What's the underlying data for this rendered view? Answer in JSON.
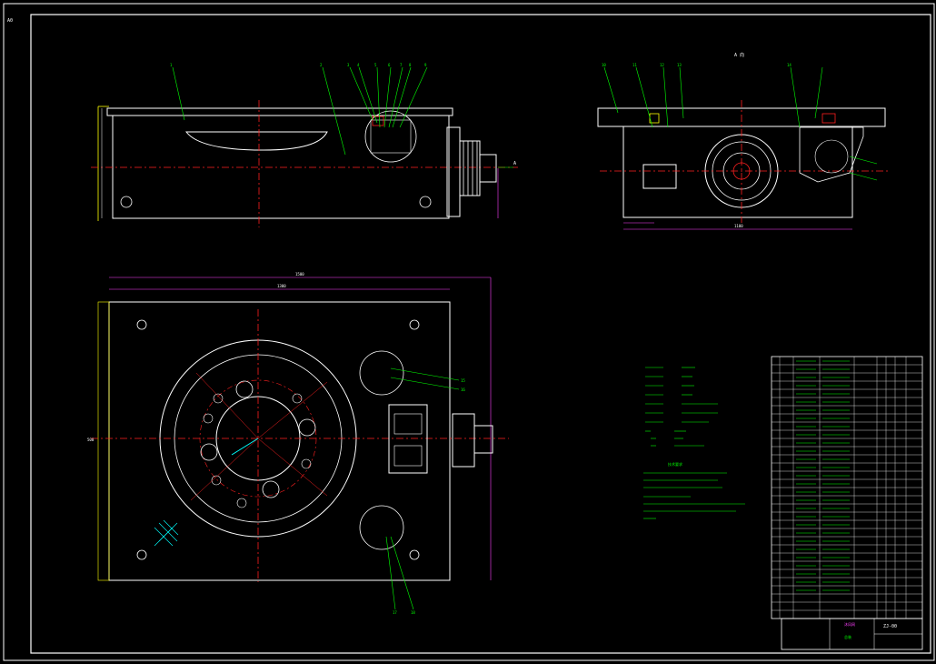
{
  "sheet": {
    "corner_label": "A0",
    "view_label": "A 向",
    "datum_label": "A",
    "dimension_values": [
      "1500",
      "1300",
      "1100",
      "500"
    ],
    "callouts_top": [
      "1",
      "2",
      "3",
      "4",
      "5",
      "6",
      "7",
      "8",
      "9",
      "10",
      "11",
      "12",
      "13",
      "14"
    ],
    "callouts_plan": [
      "15",
      "16",
      "17",
      "18"
    ],
    "tech_requirements_title": "技术要求",
    "title_block_brand": "沐风网",
    "title_block_main": "总装",
    "title_block_code": "ZJ-00"
  },
  "colors": {
    "outline": "#ffffff",
    "center_line": "#ff2020",
    "leader_line": "#00ff00",
    "hidden_line": "#ffff00",
    "dimension_line": "#ff40ff",
    "hatch": "#00ffff",
    "background": "#000000"
  }
}
